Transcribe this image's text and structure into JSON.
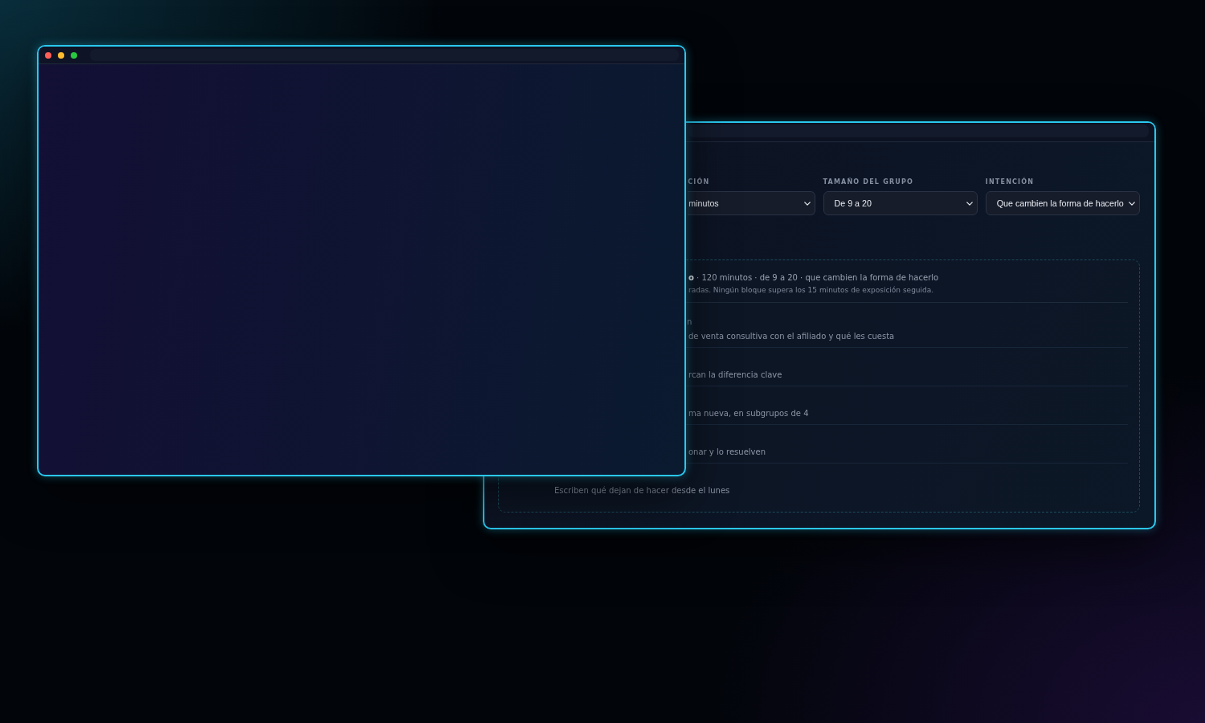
{
  "front_window": {
    "controls": [
      {
        "kind": "close"
      },
      {
        "kind": "minimize"
      },
      {
        "kind": "maximize"
      }
    ]
  },
  "back_window": {
    "filters": [
      {
        "label": "CIÓN",
        "value": "minutos"
      },
      {
        "label": "TAMAÑO DEL GRUPO",
        "value": "De 9 a 20"
      },
      {
        "label": "INTENCIÓN",
        "value": "Que cambien la forma de hacerlo"
      }
    ],
    "plan": {
      "summary": "**o** · 120 minutos · de 9 a 20 · que cambien la forma de hacerlo",
      "note": "radas. Ningún bloque supera los 15 minutos de exposición seguida.",
      "steps": [
        {
          "title": "n",
          "description": "de venta consultiva con el afiliado y qué les cuesta"
        },
        {
          "description": "rcan la diferencia clave"
        },
        {
          "description": "ma nueva, en subgrupos de 4"
        },
        {
          "description": "onar y lo resuelven"
        },
        {
          "description": "Escriben qué dejan de hacer desde el lunes"
        }
      ]
    }
  }
}
